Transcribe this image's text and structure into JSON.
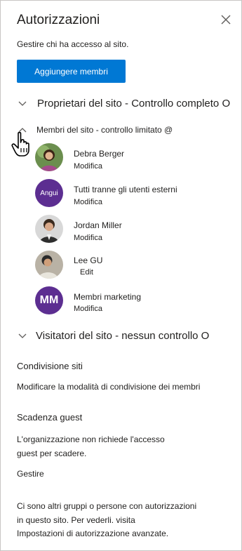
{
  "panel": {
    "title": "Autorizzazioni",
    "subtitle": "Gestire chi ha accesso al sito.",
    "add_members_label": "Aggiungere membri"
  },
  "sections": {
    "owners": {
      "label": "Proprietari del sito - Controllo completo O"
    },
    "members": {
      "label": "Membri del sito - controllo limitato @"
    },
    "visitors": {
      "label": "Visitatori del sito - nessun controllo O"
    }
  },
  "members": [
    {
      "name": "Debra Berger",
      "role": "Modifica"
    },
    {
      "name": "Tutti tranne gli utenti esterni",
      "role": "Modifica",
      "initials": "Angui"
    },
    {
      "name": "Jordan Miller",
      "role": "Modifica"
    },
    {
      "name": "Lee GU",
      "role": "Edit"
    },
    {
      "name": "Membri marketing",
      "role": "Modifica",
      "initials": "MM"
    }
  ],
  "site_sharing": {
    "heading": "Condivisione siti",
    "link": "Modificare la modalità di condivisione dei membri"
  },
  "guest_expiry": {
    "heading": "Scadenza guest",
    "line1": "L'organizzazione non richiede l'accesso",
    "line2": "guest per scadere.",
    "manage": "Gestire"
  },
  "footer": {
    "line1": "Ci sono altri gruppi o persone con autorizzazioni",
    "line2": "in questo sito. Per vederli. visita",
    "link": "Impostazioni di autorizzazione avanzate."
  },
  "colors": {
    "accent": "#0078d4",
    "purple_avatar": "#5c2e91",
    "text": "#201f1e",
    "border": "#c8c6c4"
  }
}
